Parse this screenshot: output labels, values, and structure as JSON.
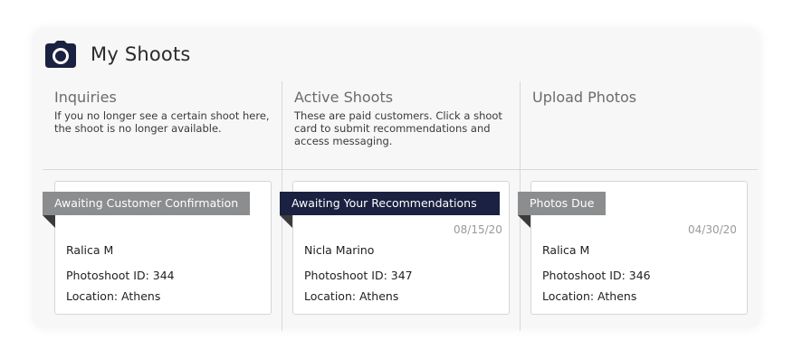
{
  "header": {
    "title": "My Shoots",
    "icon": "camera-icon"
  },
  "columns": [
    {
      "title": "Inquiries",
      "description": "If you no longer see a certain shoot here, the shoot is no longer available.",
      "card": {
        "status": "Awaiting Customer Confirmation",
        "status_color": "#8b8d8f",
        "date": "",
        "name": "Ralica M",
        "photoshoot_id": "Photoshoot ID: 344",
        "location": "Location: Athens"
      }
    },
    {
      "title": "Active Shoots",
      "description": "These are paid customers. Click a shoot card to submit recommendations and access messaging.",
      "card": {
        "status": "Awaiting Your Recommendations",
        "status_color": "#1b2140",
        "date": "08/15/20",
        "name": "Nicla Marino",
        "photoshoot_id": "Photoshoot ID: 347",
        "location": "Location: Athens"
      }
    },
    {
      "title": "Upload Photos",
      "description": "",
      "card": {
        "status": "Photos Due",
        "status_color": "#8b8d8f",
        "date": "04/30/20",
        "name": "Ralica M",
        "photoshoot_id": "Photoshoot ID: 346",
        "location": "Location: Athens"
      }
    }
  ],
  "colors": {
    "accent_dark": "#1b2140",
    "tag_gray": "#8b8d8f",
    "panel_bg": "#f7f7f8"
  }
}
